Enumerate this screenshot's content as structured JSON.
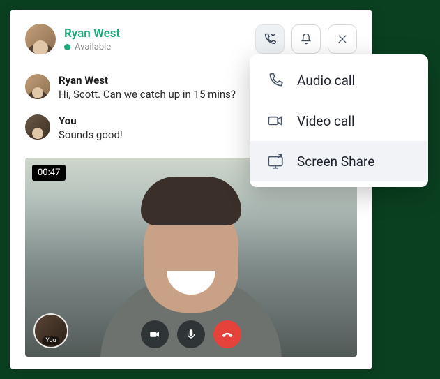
{
  "header": {
    "user_name": "Ryan West",
    "status": "Available"
  },
  "messages": [
    {
      "sender": "Ryan West",
      "text": "Hi, Scott. Can we catch up in 15 mins?"
    },
    {
      "sender": "You",
      "text": "Sounds good!"
    }
  ],
  "video_call": {
    "timer": "00:47",
    "pip_label": "You"
  },
  "call_menu": {
    "items": [
      {
        "label": "Audio call"
      },
      {
        "label": "Video call"
      },
      {
        "label": "Screen Share"
      }
    ]
  }
}
